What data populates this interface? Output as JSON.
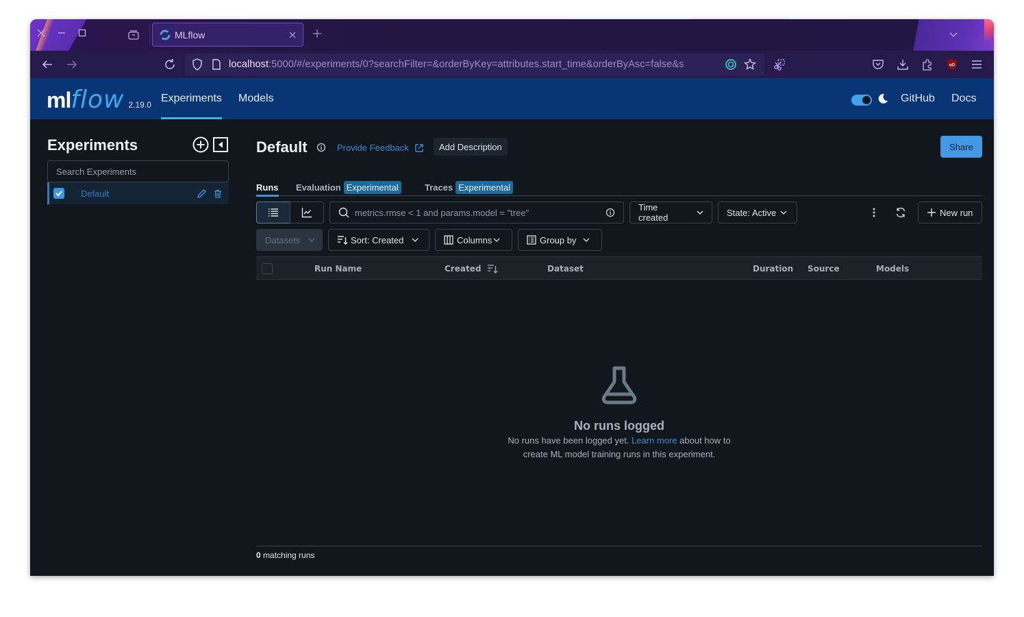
{
  "browser": {
    "tab_title": "MLflow",
    "url_host": "localhost",
    "url_rest": ":5000/#/experiments/0?searchFilter=&orderByKey=attributes.start_time&orderByAsc=false&s"
  },
  "header": {
    "logo_ml": "ml",
    "logo_flow": "flow",
    "version": "2.19.0",
    "nav": [
      {
        "label": "Experiments",
        "active": true
      },
      {
        "label": "Models",
        "active": false
      }
    ],
    "github_label": "GitHub",
    "docs_label": "Docs",
    "dark_mode": true,
    "accent_color": "#43b1e6",
    "bg_color": "#0a3574"
  },
  "sidebar": {
    "title": "Experiments",
    "search_placeholder": "Search Experiments",
    "items": [
      {
        "label": "Default",
        "checked": true
      }
    ]
  },
  "main": {
    "title": "Default",
    "feedback_label": "Provide Feedback",
    "add_description_label": "Add Description",
    "share_label": "Share",
    "tabs": [
      {
        "label": "Runs",
        "active": true,
        "badge": ""
      },
      {
        "label": "Evaluation",
        "active": false,
        "badge": "Experimental"
      },
      {
        "label": "Traces",
        "active": false,
        "badge": "Experimental"
      }
    ],
    "toolbar": {
      "search_placeholder": "metrics.rmse < 1 and params.model = \"tree\"",
      "time_filter": "Time created",
      "state_filter": "State: Active",
      "new_run_label": "New run",
      "datasets_label": "Datasets",
      "sort_label": "Sort: Created",
      "columns_label": "Columns",
      "group_by_label": "Group by"
    },
    "table": {
      "columns": [
        "Run Name",
        "Created",
        "Dataset",
        "Duration",
        "Source",
        "Models"
      ]
    },
    "empty_state": {
      "title": "No runs logged",
      "text_before": "No runs have been logged yet. ",
      "link": "Learn more",
      "text_after": " about how to create ML model training runs in this experiment."
    },
    "footer": {
      "count": "0",
      "suffix": " matching runs"
    }
  }
}
